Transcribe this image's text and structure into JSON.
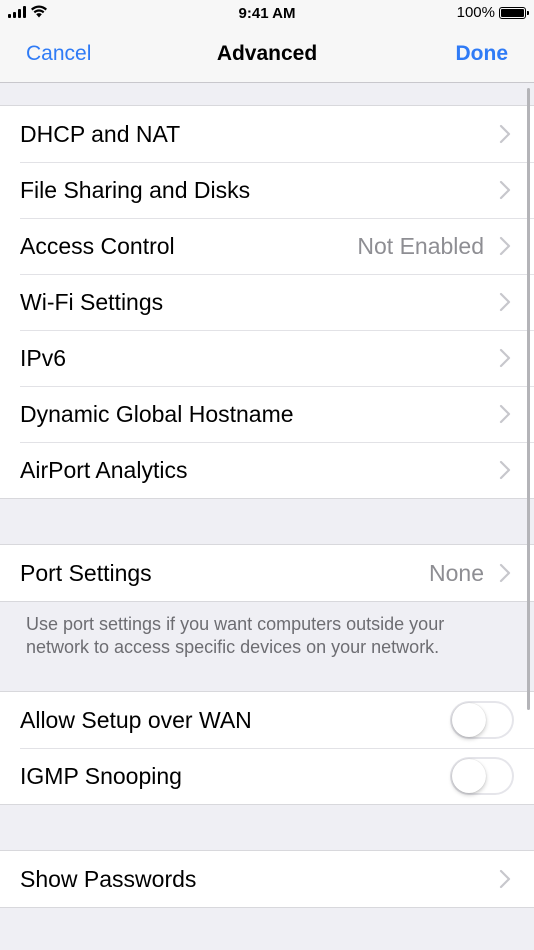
{
  "status_bar": {
    "time": "9:41 AM",
    "battery_percent": "100%",
    "battery_level": 1.0,
    "icons": [
      "signal-icon",
      "wifi-icon",
      "battery-icon"
    ]
  },
  "nav": {
    "cancel_label": "Cancel",
    "title": "Advanced",
    "done_label": "Done"
  },
  "section1": {
    "items": [
      {
        "label": "DHCP and NAT",
        "value": ""
      },
      {
        "label": "File Sharing and Disks",
        "value": ""
      },
      {
        "label": "Access Control",
        "value": "Not Enabled"
      },
      {
        "label": "Wi-Fi Settings",
        "value": ""
      },
      {
        "label": "IPv6",
        "value": ""
      },
      {
        "label": "Dynamic Global Hostname",
        "value": ""
      },
      {
        "label": "AirPort Analytics",
        "value": ""
      }
    ]
  },
  "section2": {
    "port_settings": {
      "label": "Port Settings",
      "value": "None"
    },
    "footer": "Use port settings if you want computers outside your network to access specific devices on your network."
  },
  "section3": {
    "allow_setup_wan": {
      "label": "Allow Setup over WAN",
      "enabled": false
    },
    "igmp_snooping": {
      "label": "IGMP Snooping",
      "enabled": false
    }
  },
  "section4": {
    "show_passwords": {
      "label": "Show Passwords"
    }
  },
  "colors": {
    "accent": "#2f7bf6",
    "background": "#efeff4",
    "secondary_text": "#8e8e93"
  }
}
